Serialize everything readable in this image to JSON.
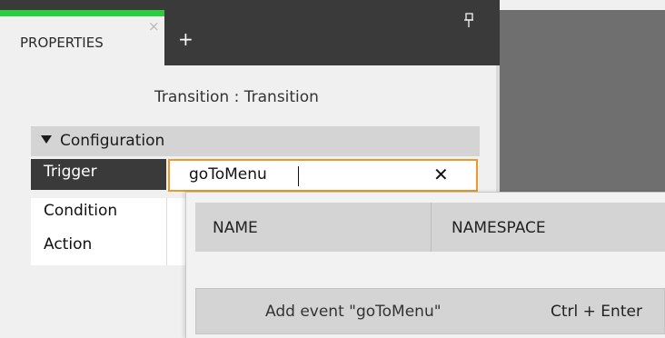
{
  "tabs": {
    "active_label": "PROPERTIES",
    "close_glyph": "×",
    "add_glyph": "+",
    "pin_glyph": "ꟼ",
    "accent_color": "#2ecc40"
  },
  "properties": {
    "subtitle": "Transition : Transition",
    "section_label": "Configuration",
    "rows": [
      {
        "label": "Trigger"
      },
      {
        "label": "Condition"
      },
      {
        "label": "Action"
      }
    ],
    "trigger_value": "goToMenu",
    "clear_glyph": "✕",
    "input_border_color": "#e89a2c"
  },
  "dropdown": {
    "columns": [
      "NAME",
      "NAMESPACE"
    ],
    "add_label": "Add event \"goToMenu\"",
    "add_shortcut": "Ctrl + Enter"
  }
}
